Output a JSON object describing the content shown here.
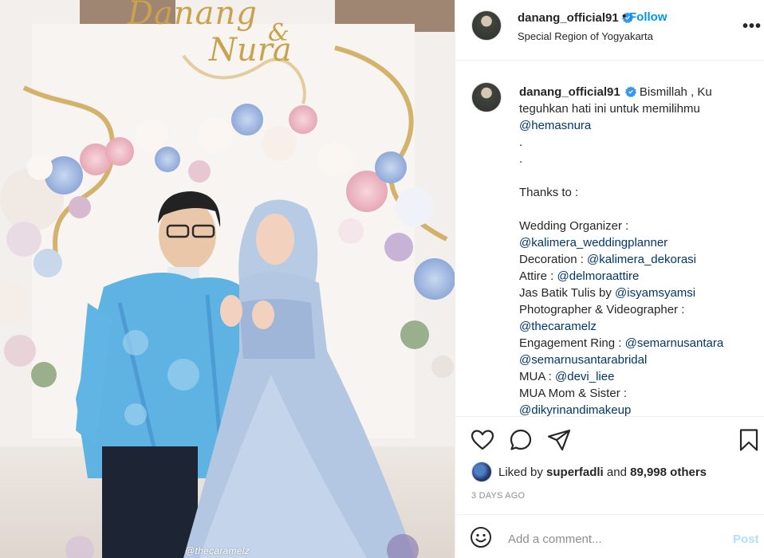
{
  "post": {
    "author": "danang_official91",
    "location": "Special Region of Yogyakarta",
    "follow_label": "Follow",
    "separator": "•",
    "more_label": "•••",
    "photo_watermark": "@thecaramelz",
    "photo_logo_line1": "Danang",
    "photo_logo_amp": "&",
    "photo_logo_line2": "Nura"
  },
  "caption": {
    "username": "danang_official91",
    "line1": "Bismillah , Ku",
    "line2": "teguhkan hati ini untuk memilihmu",
    "mention_main": "@hemasnura",
    "dot": ".",
    "thanks": "Thanks to :",
    "credits": [
      {
        "label": "Wedding Organizer :",
        "mention": ""
      },
      {
        "label": "",
        "mention": "@kalimera_weddingplanner"
      },
      {
        "label": "Decoration : ",
        "mention": "@kalimera_dekorasi"
      },
      {
        "label": "Attire : ",
        "mention": "@delmoraattire"
      },
      {
        "label": "Jas Batik Tulis by ",
        "mention": "@isyamsyamsi"
      },
      {
        "label": "Photographer & Videographer :",
        "mention": ""
      },
      {
        "label": "",
        "mention": "@thecaramelz"
      },
      {
        "label": "Engagement Ring : ",
        "mention": "@semarnusantara"
      },
      {
        "label": "",
        "mention": "@semarnusantarabridal"
      },
      {
        "label": "MUA : ",
        "mention": "@devi_liee"
      },
      {
        "label": "MUA Mom & Sister :",
        "mention": ""
      },
      {
        "label": "",
        "mention": "@dikyrinandimakeup"
      }
    ]
  },
  "likes": {
    "prefix": "Liked by ",
    "liker": "superfadli",
    "middle": " and ",
    "others": "89,998 others"
  },
  "timestamp": "3 DAYS AGO",
  "comment_box": {
    "placeholder": "Add a comment...",
    "post_label": "Post"
  },
  "icons": {
    "like": "heart-icon",
    "comment": "comment-icon",
    "share": "paper-plane-icon",
    "save": "bookmark-icon",
    "verified": "verified-badge-icon",
    "emoji": "emoji-icon"
  },
  "colors": {
    "link": "#0095f6",
    "mention": "#00376b",
    "muted": "#8e8e8e",
    "post_disabled": "#b2dffc"
  }
}
